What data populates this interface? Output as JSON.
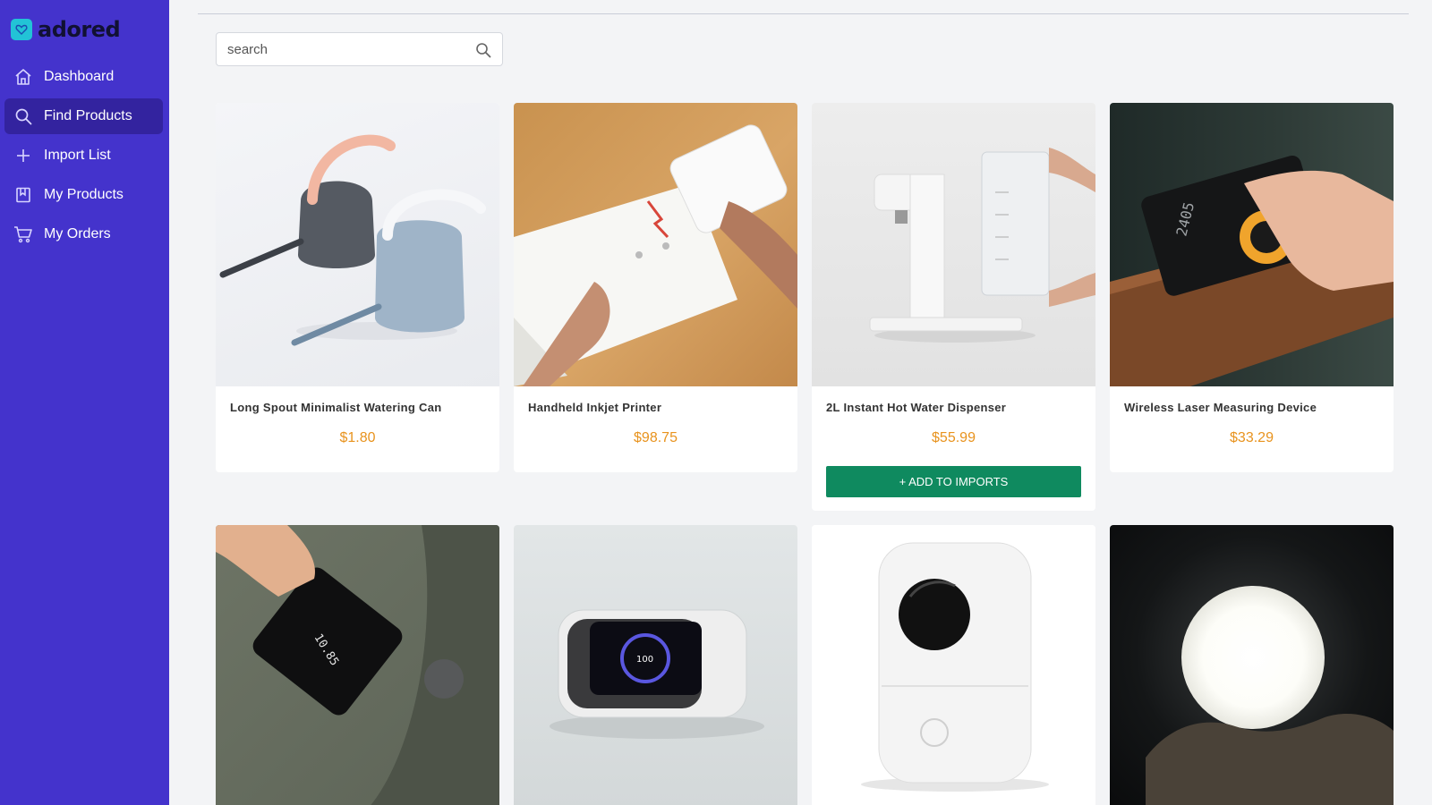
{
  "brand": {
    "name": "adored"
  },
  "nav": {
    "items": [
      {
        "label": "Dashboard",
        "icon": "home-icon",
        "active": false
      },
      {
        "label": "Find Products",
        "icon": "search-icon",
        "active": true
      },
      {
        "label": "Import List",
        "icon": "plus-icon",
        "active": false
      },
      {
        "label": "My Products",
        "icon": "bookmark-icon",
        "active": false
      },
      {
        "label": "My Orders",
        "icon": "cart-icon",
        "active": false
      }
    ]
  },
  "search": {
    "placeholder": "search",
    "value": ""
  },
  "products": [
    {
      "title": "Long Spout Minimalist Watering Can",
      "price": "$1.80",
      "image": "watering-can-image"
    },
    {
      "title": "Handheld Inkjet Printer",
      "price": "$98.75",
      "image": "inkjet-printer-image"
    },
    {
      "title": "2L Instant Hot Water Dispenser",
      "price": "$55.99",
      "image": "water-dispenser-image",
      "action_label": "+ ADD TO IMPORTS"
    },
    {
      "title": "Wireless Laser Measuring Device",
      "price": "$33.29",
      "image": "laser-measure-image"
    },
    {
      "image": "digital-tape-measure-image"
    },
    {
      "image": "wireless-charger-speaker-image"
    },
    {
      "image": "label-printer-image"
    },
    {
      "image": "moon-lamp-image"
    }
  ],
  "colors": {
    "sidebar": "#4433cc",
    "sidebar_active": "#33239f",
    "logo_accent": "#22c3d6",
    "price": "#e8931e",
    "primary_button": "#0f8a5f"
  }
}
